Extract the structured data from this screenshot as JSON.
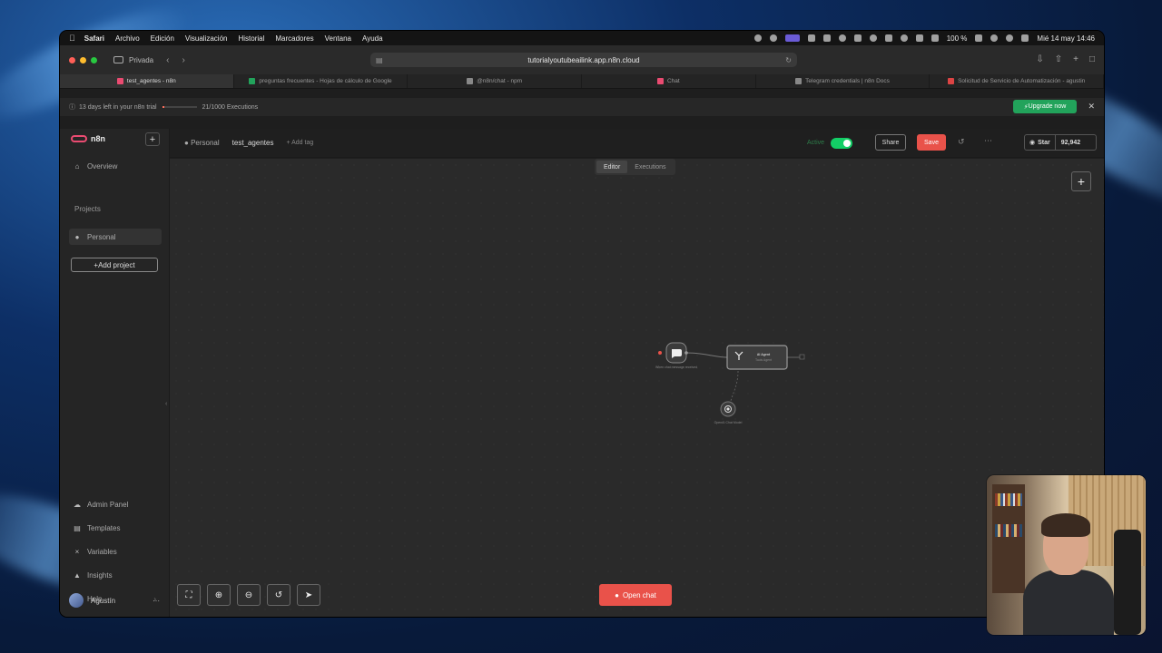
{
  "menubar": {
    "app": "Safari",
    "items": [
      "Archivo",
      "Edición",
      "Visualización",
      "Historial",
      "Marcadores",
      "Ventana",
      "Ayuda"
    ],
    "battery": "100 %",
    "datetime": "Mié 14 may 14:46"
  },
  "browser": {
    "private_label": "Privada",
    "url": "tutorialyoutubeailink.app.n8n.cloud",
    "tabs": [
      {
        "label": "test_agentes - n8n",
        "active": true
      },
      {
        "label": "preguntas frecuentes - Hojas de cálculo de Google",
        "active": false
      },
      {
        "label": "@n8n/chat - npm",
        "active": false
      },
      {
        "label": "Chat",
        "active": false
      },
      {
        "label": "Telegram credentials | n8n Docs",
        "active": false
      },
      {
        "label": "Solicitud de Servicio de Automatización - agustin",
        "active": false
      }
    ]
  },
  "banner": {
    "trial_text": "13 days left in your n8n trial",
    "executions_text": "21/1000 Executions",
    "executions_used": 21,
    "executions_total": 1000,
    "upgrade_label": "Upgrade now"
  },
  "sidebar": {
    "logo": "n8n",
    "overview": "Overview",
    "projects_label": "Projects",
    "personal": "Personal",
    "add_project": "Add project",
    "admin_panel": "Admin Panel",
    "templates": "Templates",
    "variables": "Variables",
    "insights": "Insights",
    "help": "Help",
    "user": "Agustín"
  },
  "header": {
    "project": "Personal",
    "workflow_name": "test_agentes",
    "add_tag": "+ Add tag",
    "active_label": "Active",
    "share": "Share",
    "save": "Save",
    "github_star": "Star",
    "github_count": "92,942"
  },
  "canvas": {
    "tab_editor": "Editor",
    "tab_executions": "Executions",
    "open_chat": "Open chat",
    "nodes": {
      "trigger": "When chat message received",
      "agent_title": "AI Agent",
      "agent_sub": "Tools Agent",
      "model": "OpenAI Chat Model"
    }
  },
  "colors": {
    "accent_red": "#e9524a",
    "active_green": "#13ce66",
    "upgrade_green": "#22a35b"
  }
}
